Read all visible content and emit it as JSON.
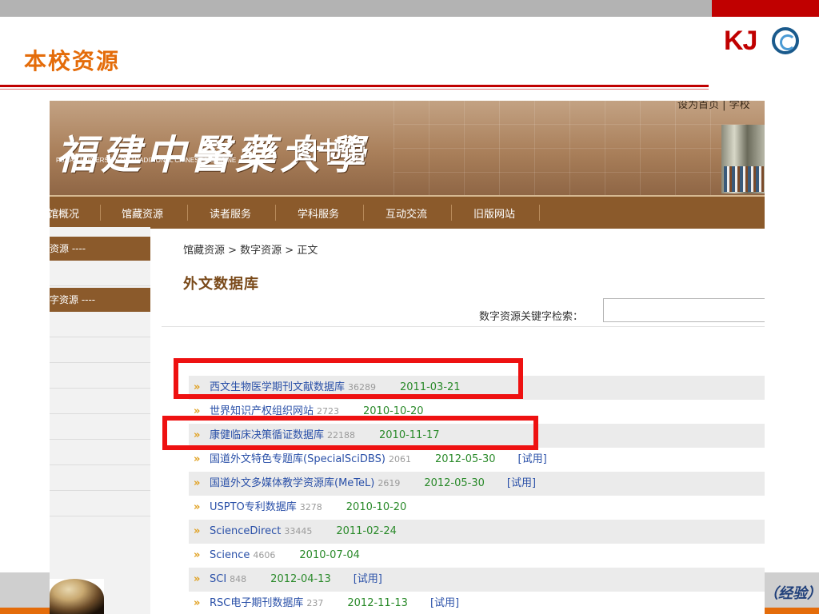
{
  "slide": {
    "title": "本校资源",
    "logo_text": "KJ",
    "footer_text": "（经验）"
  },
  "site": {
    "calligraphy": "福建中醫藥大學",
    "english_name": "FUJIAN UNIVERSITY OF TRADITIONAL CHINESE MEDICINE",
    "library_label": "图书馆",
    "top_links": "设为首页 | 学校",
    "nav": [
      "馆概况",
      "馆藏资源",
      "读者服务",
      "学科服务",
      "互动交流",
      "旧版网站"
    ],
    "left_heads": [
      "资源 ----",
      "字资源 ----"
    ],
    "breadcrumb": "馆藏资源 > 数字资源 > 正文",
    "page_heading": "外文数据库",
    "search_label": "数字资源关键字检索：",
    "search_value": "",
    "databases": [
      {
        "title": "西文生物医学期刊文献数据库",
        "count": "36289",
        "date": "2011-03-21",
        "trial": ""
      },
      {
        "title": "世界知识产权组织网站",
        "count": "2723",
        "date": "2010-10-20",
        "trial": ""
      },
      {
        "title": "康健临床决策循证数据库",
        "count": "22188",
        "date": "2010-11-17",
        "trial": ""
      },
      {
        "title": "国道外文特色专题库(SpecialSciDBS)",
        "count": "2061",
        "date": "2012-05-30",
        "trial": "[试用]"
      },
      {
        "title": "国道外文多媒体教学资源库(MeTeL)",
        "count": "2619",
        "date": "2012-05-30",
        "trial": "[试用]"
      },
      {
        "title": "USPTO专利数据库",
        "count": "3278",
        "date": "2010-10-20",
        "trial": ""
      },
      {
        "title": "ScienceDirect",
        "count": "33445",
        "date": "2011-02-24",
        "trial": ""
      },
      {
        "title": "Science",
        "count": "4606",
        "date": "2010-07-04",
        "trial": ""
      },
      {
        "title": "SCI",
        "count": "848",
        "date": "2012-04-13",
        "trial": "[试用]"
      },
      {
        "title": "RSC电子期刊数据库",
        "count": "237",
        "date": "2012-11-13",
        "trial": "[试用]"
      }
    ]
  },
  "colors": {
    "title_orange": "#e46c0a",
    "accent_red": "#c00000",
    "nav_brown": "#8b5a2b",
    "link_blue": "#2a50a8",
    "date_green": "#2a8a2a",
    "highlight_red": "#ee1111"
  },
  "icons": {
    "bullet": "double-chevron-right-icon",
    "logo": "kj-logo-circle-icon"
  }
}
